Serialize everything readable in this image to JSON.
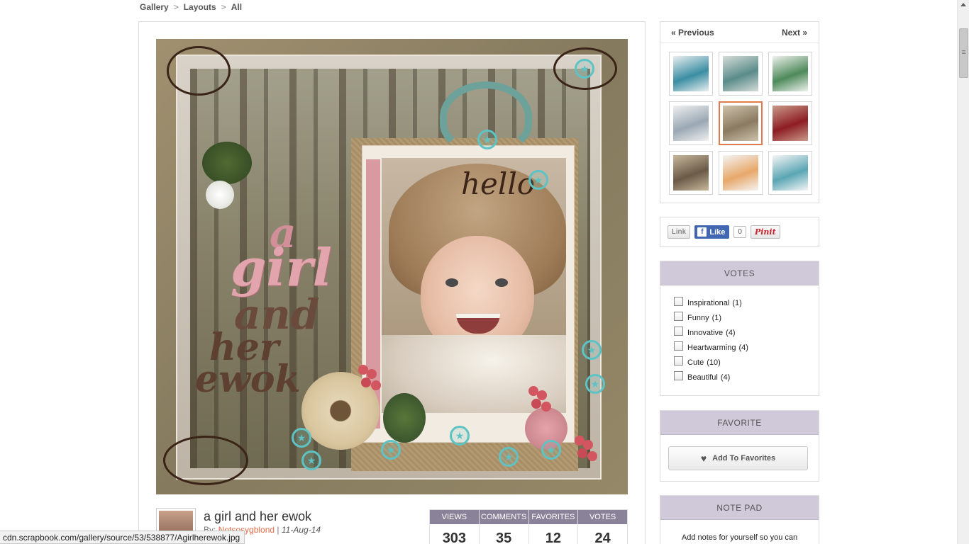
{
  "breadcrumb": {
    "items": [
      "Gallery",
      "Layouts",
      "All"
    ],
    "separator": ">"
  },
  "artwork": {
    "title_words": [
      "a",
      "girl",
      "and",
      "her",
      "ewok"
    ],
    "hello_text": "hello",
    "star_icon": "★"
  },
  "item": {
    "title": "a girl and her ewok",
    "by_prefix": "By:",
    "author": "Notsosygblond",
    "separator": "|",
    "date": "11-Aug-14"
  },
  "stats": [
    {
      "label": "VIEWS",
      "value": "303"
    },
    {
      "label": "COMMENTS",
      "value": "35"
    },
    {
      "label": "FAVORITES",
      "value": "12"
    },
    {
      "label": "VOTES",
      "value": "24"
    }
  ],
  "nav": {
    "previous": "« Previous",
    "next": "Next »"
  },
  "thumbnails": [
    {
      "colors": [
        "#3a8ea3",
        "#e9eef0"
      ],
      "current": false
    },
    {
      "colors": [
        "#5a8c8a",
        "#d5dcd8"
      ],
      "current": false
    },
    {
      "colors": [
        "#4e8a5a",
        "#eef2ee"
      ],
      "current": false
    },
    {
      "colors": [
        "#9aa8b4",
        "#f0f0f0"
      ],
      "current": false
    },
    {
      "colors": [
        "#8a7a62",
        "#cfc2ab"
      ],
      "current": true
    },
    {
      "colors": [
        "#8e1d22",
        "#c99a8a"
      ],
      "current": false
    },
    {
      "colors": [
        "#6a5a48",
        "#c8b89c"
      ],
      "current": false
    },
    {
      "colors": [
        "#e8a86a",
        "#f4f4f4"
      ],
      "current": false
    },
    {
      "colors": [
        "#5aa6b4",
        "#f6f6f6"
      ],
      "current": false
    }
  ],
  "share": {
    "link_label": "Link",
    "like_label": "Like",
    "like_count": "0",
    "pin_label": "Pinit"
  },
  "votes": {
    "header": "VOTES",
    "items": [
      {
        "label": "Inspirational",
        "count": "(1)"
      },
      {
        "label": "Funny",
        "count": "(1)"
      },
      {
        "label": "Innovative",
        "count": "(4)"
      },
      {
        "label": "Heartwarming",
        "count": "(4)"
      },
      {
        "label": "Cute",
        "count": "(10)"
      },
      {
        "label": "Beautiful",
        "count": "(4)"
      }
    ]
  },
  "favorite": {
    "header": "FAVORITE",
    "button_label": "Add To Favorites",
    "icon": "heart-icon"
  },
  "notepad": {
    "header": "NOTE PAD",
    "text": "Add notes for yourself so you can"
  },
  "status_url": "cdn.scrapbook.com/gallery/source/53/538877/Agirlherewok.jpg",
  "colors": {
    "accent_orange": "#e27a4e",
    "header_lavender": "#cfc9d9",
    "stats_header": "#8a8298",
    "facebook_blue": "#4267b2",
    "star_teal": "#5ec3c4"
  }
}
